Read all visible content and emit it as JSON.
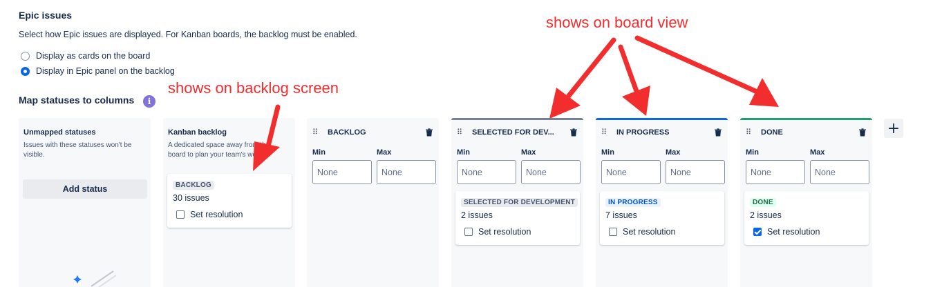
{
  "epic": {
    "heading": "Epic issues",
    "description": "Select how Epic issues are displayed. For Kanban boards, the backlog must be enabled.",
    "options": [
      {
        "label": "Display as cards on the board",
        "selected": false
      },
      {
        "label": "Display in Epic panel on the backlog",
        "selected": true
      }
    ]
  },
  "map": {
    "heading": "Map statuses to columns",
    "info_icon": "i"
  },
  "unmapped": {
    "title": "Unmapped statuses",
    "description": "Issues with these statuses won't be visible.",
    "add_label": "Add status"
  },
  "kanban": {
    "title": "Kanban backlog",
    "description": "A dedicated space away from the board to plan your team's work.",
    "status": "BACKLOG",
    "count": "30 issues",
    "resolution": "Set resolution",
    "resolution_checked": false
  },
  "columns": [
    {
      "name": "BACKLOG",
      "min_label": "Min",
      "max_label": "Max",
      "min_placeholder": "None",
      "max_placeholder": "None"
    },
    {
      "name": "SELECTED FOR DEV...",
      "min_label": "Min",
      "max_label": "Max",
      "min_placeholder": "None",
      "max_placeholder": "None",
      "status": "SELECTED FOR DEVELOPMENT",
      "count": "2 issues",
      "resolution": "Set resolution",
      "resolution_checked": false
    },
    {
      "name": "IN PROGRESS",
      "min_label": "Min",
      "max_label": "Max",
      "min_placeholder": "None",
      "max_placeholder": "None",
      "status": "IN PROGRESS",
      "count": "7 issues",
      "resolution": "Set resolution",
      "resolution_checked": false
    },
    {
      "name": "DONE",
      "min_label": "Min",
      "max_label": "Max",
      "min_placeholder": "None",
      "max_placeholder": "None",
      "status": "DONE",
      "count": "2 issues",
      "resolution": "Set resolution",
      "resolution_checked": true
    }
  ],
  "add_column": "+",
  "annotations": {
    "board": "shows on board view",
    "backlog": "shows on backlog screen"
  },
  "colors": {
    "primary": "#0c66e4",
    "annotation": "#f22d2d",
    "selected_bar": "#758195",
    "progress_bar": "#0c66e4",
    "done_bar": "#22a06b"
  }
}
